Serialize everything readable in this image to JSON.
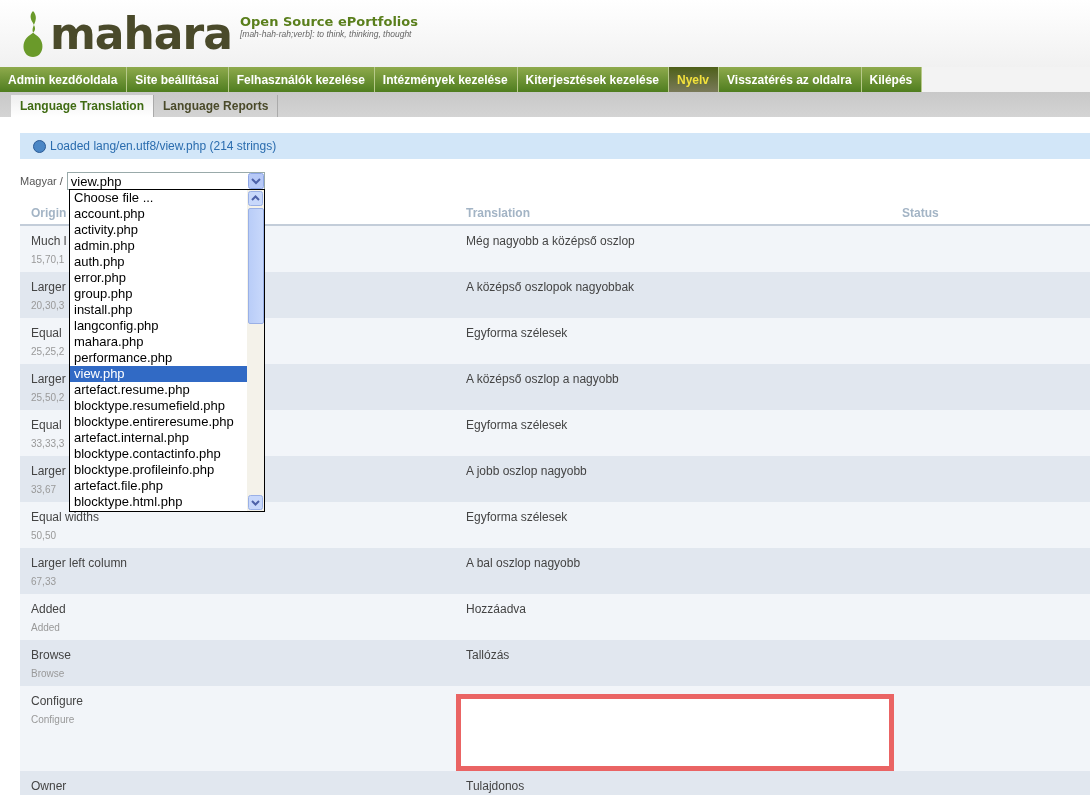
{
  "header": {
    "logo": "mahara",
    "tagline": "Open Source ePortfolios",
    "definition": "[mah-hah-rah;verb]: to think, thinking, thought"
  },
  "nav": [
    {
      "label": "Admin kezdőoldala",
      "selected": false
    },
    {
      "label": "Site beállításai",
      "selected": false
    },
    {
      "label": "Felhasználók kezelése",
      "selected": false
    },
    {
      "label": "Intézmények kezelése",
      "selected": false
    },
    {
      "label": "Kiterjesztések kezelése",
      "selected": false
    },
    {
      "label": "Nyelv",
      "selected": true
    },
    {
      "label": "Visszatérés az oldalra",
      "selected": false
    },
    {
      "label": "Kilépés",
      "selected": false
    }
  ],
  "subnav": [
    {
      "label": "Language Translation",
      "selected": true
    },
    {
      "label": "Language Reports",
      "selected": false
    }
  ],
  "message": "Loaded lang/en.utf8/view.php (214 strings)",
  "file_select": {
    "prefix": "Magyar /",
    "value": "view.php",
    "options": [
      {
        "label": "Choose file ...",
        "selected": false
      },
      {
        "label": "account.php",
        "selected": false
      },
      {
        "label": "activity.php",
        "selected": false
      },
      {
        "label": "admin.php",
        "selected": false
      },
      {
        "label": "auth.php",
        "selected": false
      },
      {
        "label": "error.php",
        "selected": false
      },
      {
        "label": "group.php",
        "selected": false
      },
      {
        "label": "install.php",
        "selected": false
      },
      {
        "label": "langconfig.php",
        "selected": false
      },
      {
        "label": "mahara.php",
        "selected": false
      },
      {
        "label": "performance.php",
        "selected": false
      },
      {
        "label": "view.php",
        "selected": true
      },
      {
        "label": "artefact.resume.php",
        "selected": false
      },
      {
        "label": "blocktype.resumefield.php",
        "selected": false
      },
      {
        "label": "blocktype.entireresume.php",
        "selected": false
      },
      {
        "label": "artefact.internal.php",
        "selected": false
      },
      {
        "label": "blocktype.contactinfo.php",
        "selected": false
      },
      {
        "label": "blocktype.profileinfo.php",
        "selected": false
      },
      {
        "label": "artefact.file.php",
        "selected": false
      },
      {
        "label": "blocktype.html.php",
        "selected": false
      }
    ]
  },
  "table": {
    "columns": [
      "Origin",
      "Translation",
      "Status"
    ],
    "rows": [
      {
        "original": "Much l",
        "key": "15,70,1",
        "translation": "Még nagyobb a középső oszlop",
        "kind": "text"
      },
      {
        "original": "Larger",
        "key": "20,30,3",
        "translation": "A középső oszlopok nagyobbak",
        "kind": "text"
      },
      {
        "original": "Equal",
        "key": "25,25,2",
        "translation": "Egyforma szélesek",
        "kind": "text"
      },
      {
        "original": "Larger",
        "key": "25,50,2",
        "translation": "A középső oszlop a nagyobb",
        "kind": "text"
      },
      {
        "original": "Equal",
        "key": "33,33,3",
        "translation": "Egyforma szélesek",
        "kind": "text"
      },
      {
        "original": "Larger",
        "key": "33,67",
        "translation": "A jobb oszlop nagyobb",
        "kind": "text"
      },
      {
        "original": "Equal widths",
        "key": "50,50",
        "translation": "Egyforma szélesek",
        "kind": "text"
      },
      {
        "original": "Larger left column",
        "key": "67,33",
        "translation": "A bal oszlop nagyobb",
        "kind": "text"
      },
      {
        "original": "Added",
        "key": "Added",
        "translation": "Hozzáadva",
        "kind": "text"
      },
      {
        "original": "Browse",
        "key": "Browse",
        "translation": "Tallózás",
        "kind": "text"
      },
      {
        "original": "Configure",
        "key": "Configure",
        "kind": "editor"
      },
      {
        "original": "Owner",
        "translation": "Tulajdonos",
        "kind": "text"
      }
    ]
  }
}
